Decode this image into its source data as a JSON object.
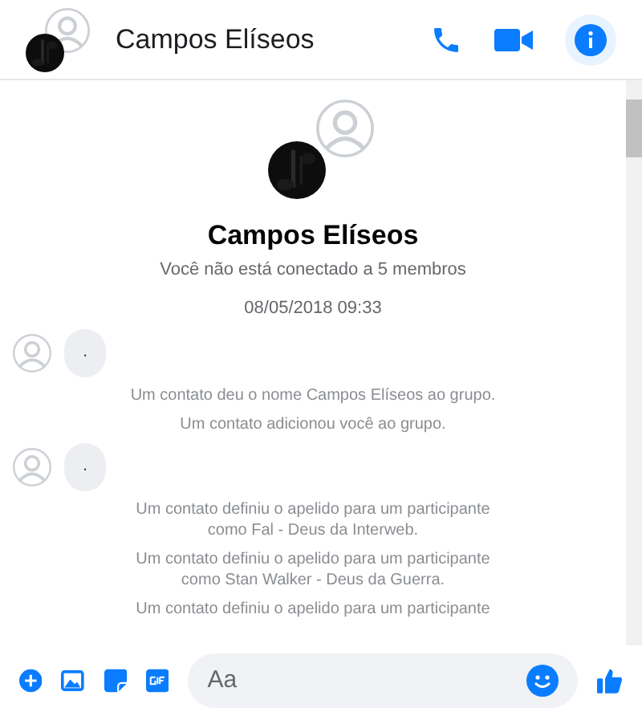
{
  "header": {
    "title": "Campos Elíseos"
  },
  "group": {
    "name": "Campos Elíseos",
    "subtitle": "Você não está conectado a 5 membros"
  },
  "messages": [
    {
      "kind": "timestamp",
      "text": "08/05/2018 09:33"
    },
    {
      "kind": "bubble",
      "text": "."
    },
    {
      "kind": "notice",
      "text": "Um contato deu o nome Campos Elíseos ao grupo."
    },
    {
      "kind": "notice",
      "text": "Um contato adicionou você ao grupo."
    },
    {
      "kind": "bubble",
      "text": "."
    },
    {
      "kind": "notice",
      "text": "Um contato definiu o apelido para um participante como Fal - Deus da Interweb."
    },
    {
      "kind": "notice",
      "text": "Um contato definiu o apelido para um participante como Stan Walker - Deus da Guerra."
    },
    {
      "kind": "notice",
      "text": "Um contato definiu o apelido para um participante"
    }
  ],
  "composer": {
    "placeholder": "Aa"
  }
}
